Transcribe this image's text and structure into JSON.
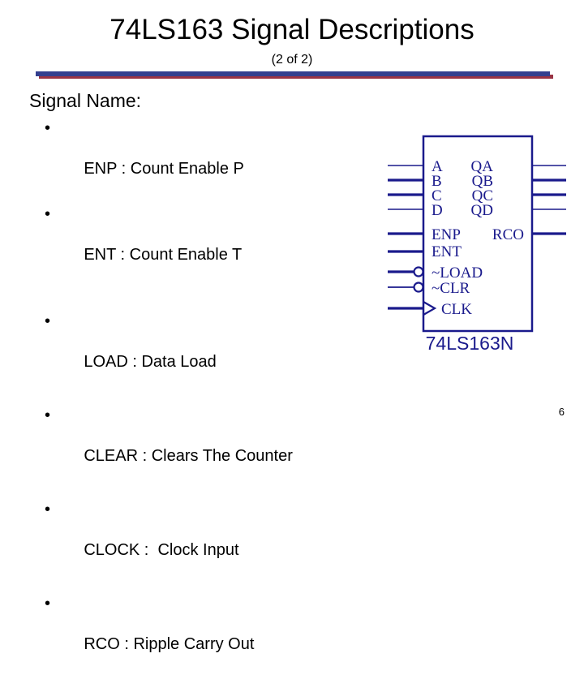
{
  "slide": {
    "title": "74LS163 Signal Descriptions",
    "subtitle": "(2 of 2)",
    "page_number": "6",
    "accent_blue": "#333f8f",
    "accent_red": "#993344",
    "schematic_color": "#1a1a8c"
  },
  "body": {
    "heading": "Signal Name:",
    "bullet_glyph": "•",
    "bullets": [
      {
        "text": "ENP : Count Enable P"
      },
      {
        "text": "ENT : Count Enable T"
      },
      {
        "text": "LOAD : Data Load"
      },
      {
        "text": "CLEAR : Clears The Counter"
      },
      {
        "text": "CLOCK :  Clock Input"
      },
      {
        "text": "RCO : Ripple Carry Out"
      }
    ]
  },
  "schematic": {
    "part_label": "74LS163N",
    "inputs": [
      {
        "label": "A",
        "inverted": false,
        "clock": false
      },
      {
        "label": "B",
        "inverted": false,
        "clock": false
      },
      {
        "label": "C",
        "inverted": false,
        "clock": false
      },
      {
        "label": "D",
        "inverted": false,
        "clock": false
      },
      {
        "label": "ENP",
        "inverted": false,
        "clock": false
      },
      {
        "label": "ENT",
        "inverted": false,
        "clock": false
      },
      {
        "label": "~LOAD",
        "inverted": true,
        "clock": false
      },
      {
        "label": "~CLR",
        "inverted": true,
        "clock": false
      },
      {
        "label": "CLK",
        "inverted": false,
        "clock": true
      }
    ],
    "outputs": [
      {
        "label": "QA"
      },
      {
        "label": "QB"
      },
      {
        "label": "QC"
      },
      {
        "label": "QD"
      },
      {
        "label": "RCO"
      }
    ]
  }
}
